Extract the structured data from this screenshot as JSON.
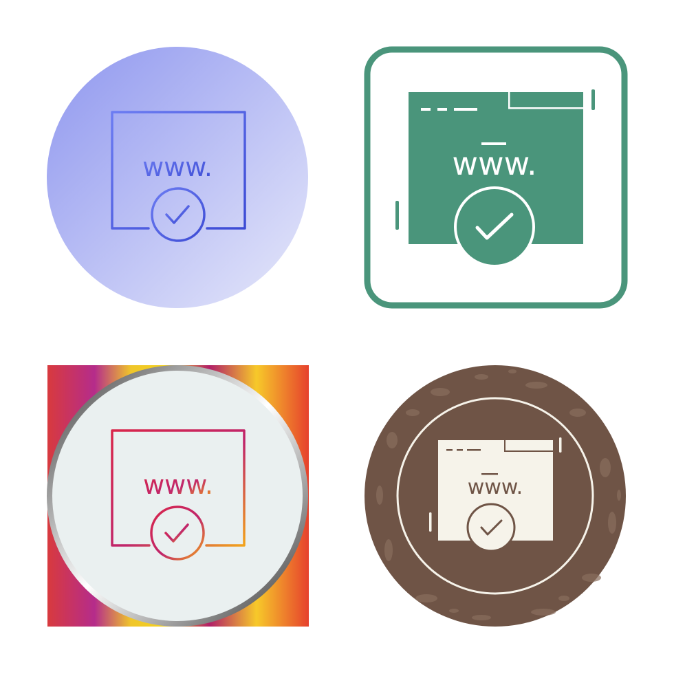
{
  "icon_set": {
    "subject": "website-verified-icon",
    "url_text": "www.",
    "variants": [
      {
        "style": "gradient-line",
        "background": "circle-gradient",
        "colors": {
          "bg_start": "#8f97ef",
          "bg_end": "#e6e8fa",
          "stroke_start": "#6c7cf2",
          "stroke_end": "#3c4bd4"
        }
      },
      {
        "style": "glyph",
        "background": "rounded-square-outline",
        "colors": {
          "accent": "#4a957b",
          "paper": "#ffffff"
        }
      },
      {
        "style": "gradient-line",
        "background": "gradient-square-with-circle",
        "colors": {
          "stroke_start": "#d9264a",
          "stroke_end": "#f2a31b",
          "circle_fill": "#eaf0f0"
        }
      },
      {
        "style": "glyph-inverse",
        "background": "textured-circle",
        "colors": {
          "badge": "#6f5446",
          "glyph": "#f6f3ea"
        }
      }
    ]
  }
}
